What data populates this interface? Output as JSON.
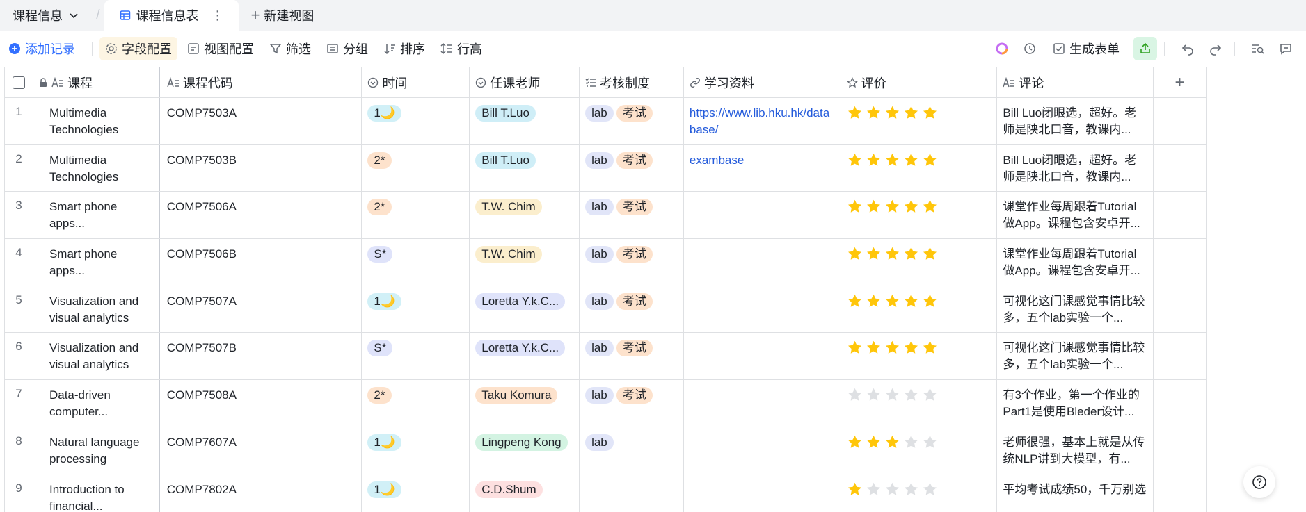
{
  "viewbar": {
    "db_name": "课程信息",
    "active_view": "课程信息表",
    "new_view": "新建视图"
  },
  "toolbar": {
    "add_record": "添加记录",
    "field_config": "字段配置",
    "view_config": "视图配置",
    "filter": "筛选",
    "group": "分组",
    "sort": "排序",
    "row_height": "行高",
    "generate_form": "生成表单"
  },
  "columns": {
    "title": "课程",
    "code": "课程代码",
    "time": "时间",
    "teacher": "任课老师",
    "exam": "考核制度",
    "material": "学习资料",
    "rating": "评价",
    "comment": "评论"
  },
  "colors": {
    "accent": "#3370ff",
    "star_on": "#ffc60a",
    "star_off": "#dee0e3"
  },
  "rows": [
    {
      "num": "1",
      "title": "Multimedia Technologies",
      "code": "COMP7503A",
      "time": "1🌙",
      "teacher": "Bill T.Luo",
      "exam": [
        "lab",
        "考试"
      ],
      "material": "https://www.lib.hku.hk/database/",
      "rating": 5,
      "comment": "Bill Luo闭眼选，超好。老师是陕北口音，教课内..."
    },
    {
      "num": "2",
      "title": "Multimedia Technologies",
      "code": "COMP7503B",
      "time": "2*",
      "teacher": "Bill T.Luo",
      "exam": [
        "lab",
        "考试"
      ],
      "material": "exambase",
      "rating": 5,
      "comment": "Bill Luo闭眼选，超好。老师是陕北口音，教课内..."
    },
    {
      "num": "3",
      "title": "Smart phone apps...",
      "code": "COMP7506A",
      "time": "2*",
      "teacher": "T.W. Chim",
      "exam": [
        "lab",
        "考试"
      ],
      "material": "",
      "rating": 5,
      "comment": "课堂作业每周跟着Tutorial做App。课程包含安卓开..."
    },
    {
      "num": "4",
      "title": "Smart phone apps...",
      "code": "COMP7506B",
      "time": "S*",
      "teacher": "T.W. Chim",
      "exam": [
        "lab",
        "考试"
      ],
      "material": "",
      "rating": 5,
      "comment": "课堂作业每周跟着Tutorial做App。课程包含安卓开..."
    },
    {
      "num": "5",
      "title": "Visualization and visual analytics",
      "code": "COMP7507A",
      "time": "1🌙",
      "teacher": "Loretta Y.k.C...",
      "exam": [
        "lab",
        "考试"
      ],
      "material": "",
      "rating": 5,
      "comment": "可视化这门课感觉事情比较多，五个lab实验一个..."
    },
    {
      "num": "6",
      "title": "Visualization and visual analytics",
      "code": "COMP7507B",
      "time": "S*",
      "teacher": "Loretta Y.k.C...",
      "exam": [
        "lab",
        "考试"
      ],
      "material": "",
      "rating": 5,
      "comment": "可视化这门课感觉事情比较多，五个lab实验一个..."
    },
    {
      "num": "7",
      "title": "Data-driven computer...",
      "code": "COMP7508A",
      "time": "2*",
      "teacher": "Taku Komura",
      "exam": [
        "lab",
        "考试"
      ],
      "material": "",
      "rating": 0,
      "comment": "有3个作业，第一个作业的Part1是使用Bleder设计..."
    },
    {
      "num": "8",
      "title": "Natural language processing",
      "code": "COMP7607A",
      "time": "1🌙",
      "teacher": "Lingpeng Kong",
      "exam": [
        "lab"
      ],
      "material": "",
      "rating": 3,
      "comment": "老师很强，基本上就是从传统NLP讲到大模型，有..."
    },
    {
      "num": "9",
      "title": "Introduction to financial...",
      "code": "COMP7802A",
      "time": "1🌙",
      "teacher": "C.D.Shum",
      "exam": [],
      "material": "",
      "rating": 1,
      "comment": "平均考试成绩50，千万别选"
    }
  ],
  "time_colors": {
    "1🌙": "#d1f0f7",
    "2*": "#fde2cc",
    "S*": "#dfe3fa"
  },
  "teacher_colors": {
    "Bill T.Luo": "#cfeef7",
    "T.W. Chim": "#fbeecd",
    "Loretta Y.k.C...": "#dfe3fa",
    "Taku Komura": "#fde2cc",
    "Lingpeng Kong": "#d3f3e2",
    "C.D.Shum": "#fde0e0"
  },
  "exam_colors": {
    "lab": "#e1e5f8",
    "考试": "#fde2cc"
  }
}
